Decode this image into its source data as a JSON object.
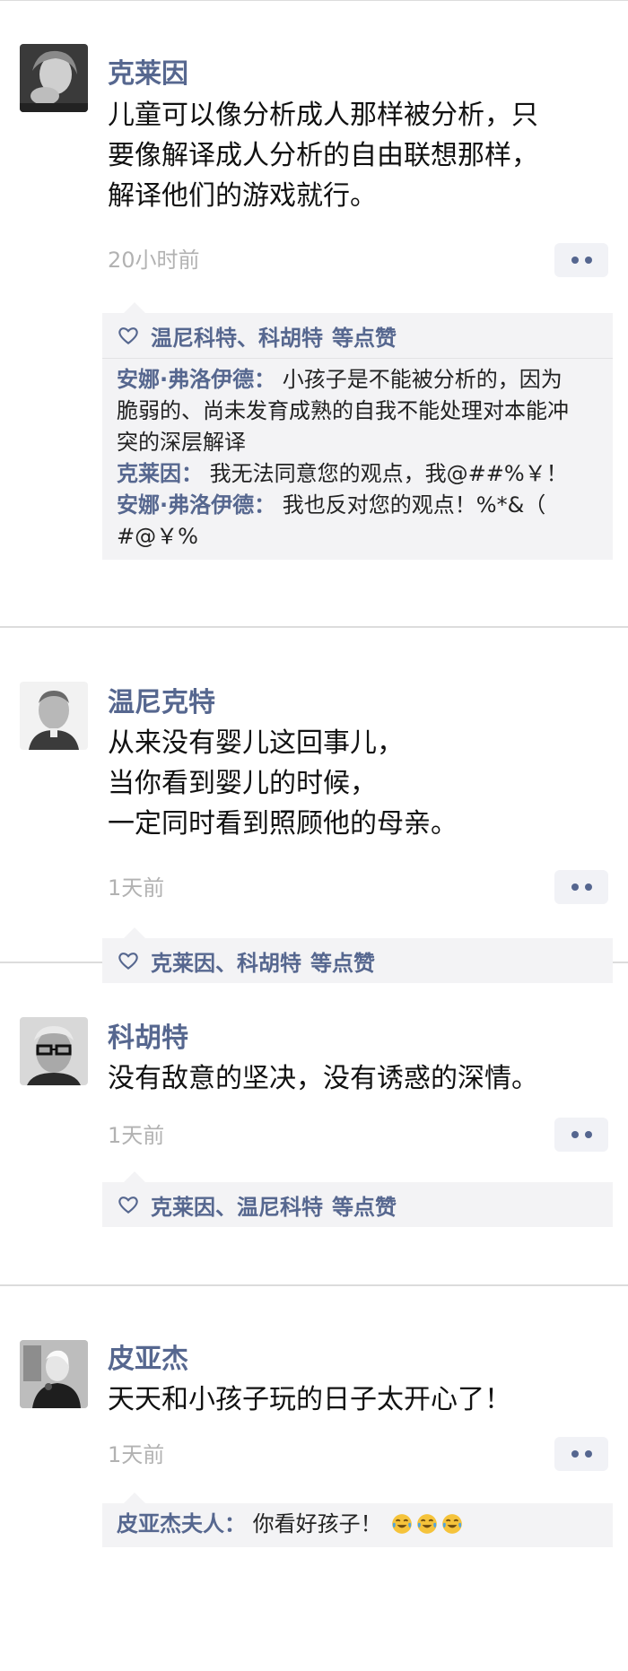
{
  "posts": [
    {
      "author": "克莱因",
      "lines": [
        "儿童可以像分析成人那样被分析，只",
        "要像解译成人分析的自由联想那样，",
        "解译他们的游戏就行。"
      ],
      "time": "20小时前",
      "likes": "温尼科特、科胡特",
      "likes_suffix": "等点赞",
      "comments": [
        {
          "who": "安娜·弗洛伊德：",
          "lines": [
            "小孩子是不能被分析的，因为",
            "脆弱的、尚未发育成熟的自我不能处理对本能冲",
            "突的深层解译"
          ]
        },
        {
          "who": "克莱因：",
          "lines": [
            "我无法同意您的观点，我@##%￥！"
          ]
        },
        {
          "who": "安娜·弗洛伊德：",
          "lines": [
            "我也反对您的观点！%*&（",
            "#@￥%"
          ]
        }
      ]
    },
    {
      "author": "温尼克特",
      "lines": [
        "从来没有婴儿这回事儿，",
        "当你看到婴儿的时候，",
        "一定同时看到照顾他的母亲。"
      ],
      "time": "1天前",
      "likes": "克莱因、科胡特",
      "likes_suffix": "等点赞"
    },
    {
      "author": "科胡特",
      "lines": [
        "没有敌意的坚决，没有诱惑的深情。"
      ],
      "time": "1天前",
      "likes": "克莱因、温尼科特",
      "likes_suffix": "等点赞"
    },
    {
      "author": "皮亚杰",
      "lines": [
        "天天和小孩子玩的日子太开心了！"
      ],
      "time": "1天前",
      "comments": [
        {
          "who": "皮亚杰夫人：",
          "lines": [
            "你看好孩子！"
          ],
          "emoji": [
            "tears-of-joy-emoji",
            "tears-of-joy-emoji",
            "tears-of-joy-emoji"
          ]
        }
      ]
    }
  ],
  "icons": {
    "like": "heart-outline-icon",
    "more": "more-dots-icon"
  },
  "colors": {
    "name": "#56678f",
    "time": "#b2b2b2",
    "panel": "#f3f3f5",
    "divider": "#dcdcdc"
  }
}
